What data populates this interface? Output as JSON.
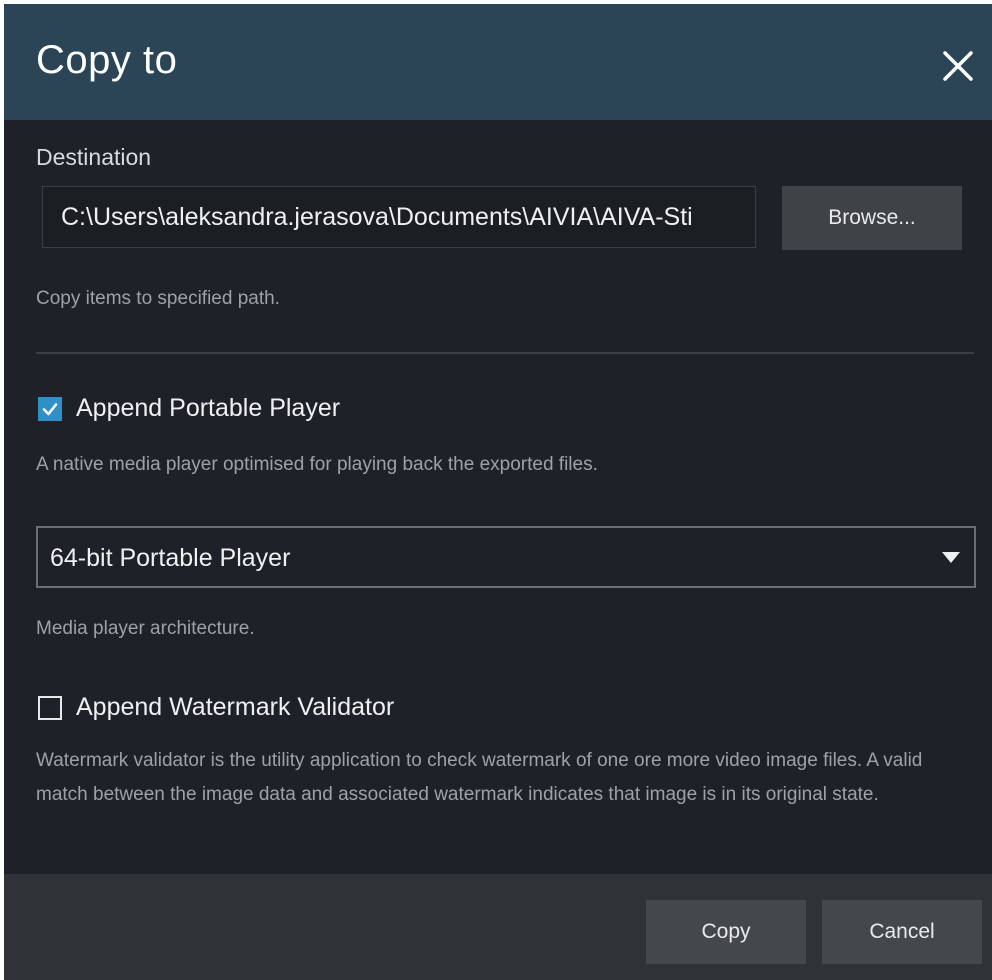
{
  "dialog": {
    "title": "Copy to",
    "close_icon": "close-icon"
  },
  "destination": {
    "label": "Destination",
    "path_value": "C:\\Users\\aleksandra.jerasova\\Documents\\AIVIA\\AIVA-Sti",
    "browse_label": "Browse...",
    "hint": "Copy items to specified path."
  },
  "portable_player": {
    "checked": true,
    "label": "Append Portable Player",
    "hint": "A native media player optimised for playing back the exported files.",
    "select_value": "64-bit Portable Player",
    "select_hint": "Media player architecture."
  },
  "watermark_validator": {
    "checked": false,
    "label": "Append Watermark Validator",
    "description": "Watermark validator is the utility application to check watermark of one ore more video image files. A valid match between the image data and associated watermark indicates that image is in its original state."
  },
  "footer": {
    "copy_label": "Copy",
    "cancel_label": "Cancel"
  },
  "colors": {
    "title_bar": "#2b4556",
    "dialog_bg": "#1e2228",
    "footer_bg": "#2f3338",
    "checkbox_accent": "#2f8fc6"
  }
}
